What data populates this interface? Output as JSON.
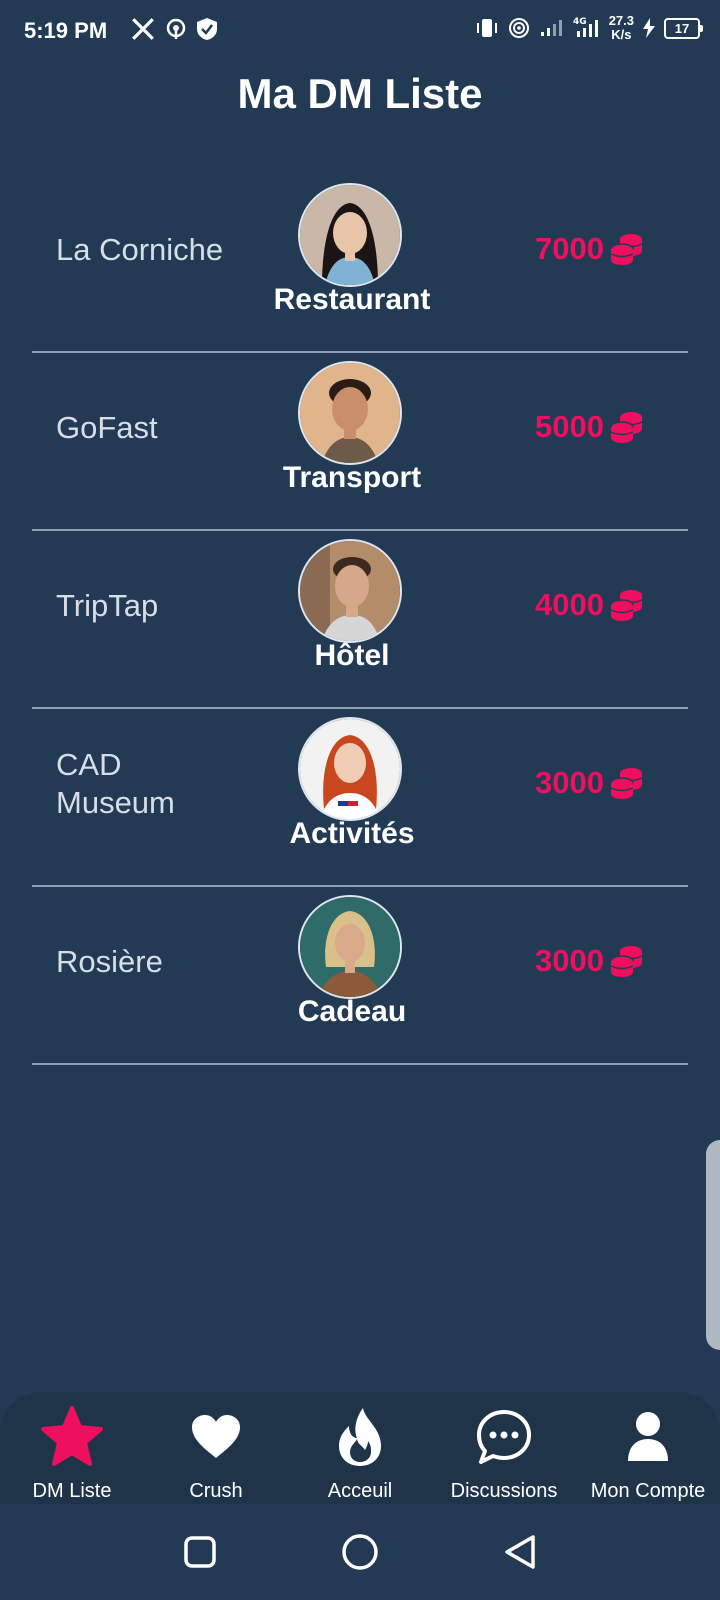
{
  "status_bar": {
    "time": "5:19 PM",
    "net_speed_value": "27.3",
    "net_speed_unit": "K/s",
    "battery": "17",
    "network_type": "4G"
  },
  "page": {
    "title": "Ma DM Liste"
  },
  "list": [
    {
      "name": "La Corniche",
      "category": "Restaurant",
      "price": "7000",
      "avatar_bg": "#c9b8a8"
    },
    {
      "name": "GoFast",
      "category": "Transport",
      "price": "5000",
      "avatar_bg": "#e0b58c"
    },
    {
      "name": "TripTap",
      "category": "Hôtel",
      "price": "4000",
      "avatar_bg": "#b38c6a"
    },
    {
      "name": "CAD\nMuseum",
      "category": "Activités",
      "price": "3000",
      "avatar_bg": "#f2f2f2"
    },
    {
      "name": "Rosière",
      "category": "Cadeau",
      "price": "3000",
      "avatar_bg": "#2f6b68"
    }
  ],
  "bottom_nav": {
    "items": [
      {
        "label": "DM Liste",
        "icon": "star-icon",
        "active": true
      },
      {
        "label": "Crush",
        "icon": "heart-icon",
        "active": false
      },
      {
        "label": "Acceuil",
        "icon": "flame-icon",
        "active": false
      },
      {
        "label": "Discussions",
        "icon": "chat-bubble-icon",
        "active": false
      },
      {
        "label": "Mon Compte",
        "icon": "user-icon",
        "active": false
      }
    ]
  },
  "colors": {
    "background": "#233a54",
    "accent": "#ee0f5e",
    "nav_background": "#1f3349"
  }
}
